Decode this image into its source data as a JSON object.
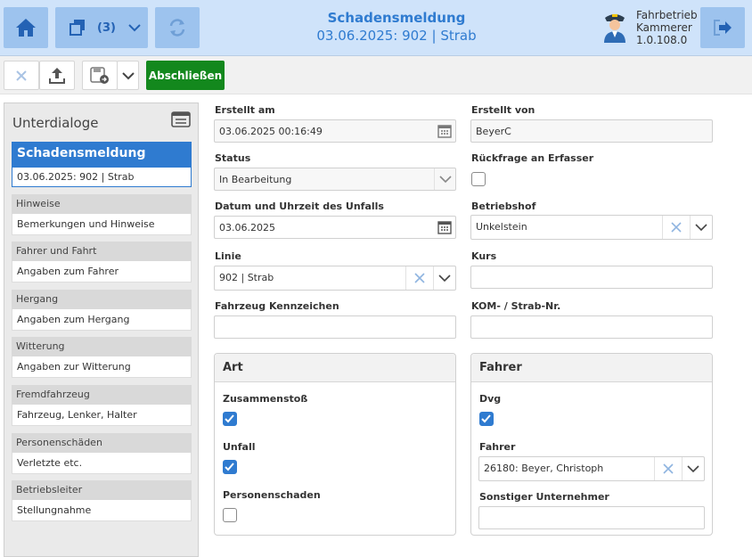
{
  "header": {
    "title": "Schadensmeldung",
    "subtitle": "03.06.2025: 902 | Strab",
    "windows_count": "(3)",
    "user_line1": "Fahrbetrieb",
    "user_line2": "Kammerer",
    "version": "1.0.108.0"
  },
  "toolbar": {
    "finish_label": "Abschließen"
  },
  "sidebar": {
    "title": "Unterdialoge",
    "active": {
      "title": "Schadensmeldung",
      "sub": "03.06.2025: 902 | Strab"
    },
    "items": [
      {
        "label": "Hinweise",
        "sub": "Bemerkungen und Hinweise"
      },
      {
        "label": "Fahrer und Fahrt",
        "sub": "Angaben zum Fahrer"
      },
      {
        "label": "Hergang",
        "sub": "Angaben zum Hergang"
      },
      {
        "label": "Witterung",
        "sub": "Angaben zur Witterung"
      },
      {
        "label": "Fremdfahrzeug",
        "sub": "Fahrzeug, Lenker, Halter"
      },
      {
        "label": "Personenschäden",
        "sub": "Verletzte etc."
      },
      {
        "label": "Betriebsleiter",
        "sub": "Stellungnahme"
      }
    ]
  },
  "form": {
    "erstellt_am": {
      "label": "Erstellt am",
      "value": "03.06.2025 00:16:49"
    },
    "erstellt_von": {
      "label": "Erstellt von",
      "value": "BeyerC"
    },
    "status": {
      "label": "Status",
      "value": "In Bearbeitung"
    },
    "rueckfrage": {
      "label": "Rückfrage an Erfasser",
      "checked": false
    },
    "datum": {
      "label": "Datum und Uhrzeit des Unfalls",
      "value": "03.06.2025"
    },
    "betriebshof": {
      "label": "Betriebshof",
      "value": "Unkelstein"
    },
    "linie": {
      "label": "Linie",
      "value": "902 | Strab"
    },
    "kurs": {
      "label": "Kurs",
      "value": ""
    },
    "kennzeichen": {
      "label": "Fahrzeug Kennzeichen",
      "value": ""
    },
    "kom": {
      "label": "KOM- / Strab-Nr.",
      "value": ""
    }
  },
  "art": {
    "title": "Art",
    "zusammenstoss": {
      "label": "Zusammenstoß",
      "checked": true
    },
    "unfall": {
      "label": "Unfall",
      "checked": true
    },
    "personenschaden": {
      "label": "Personenschaden",
      "checked": false
    }
  },
  "fahrer": {
    "title": "Fahrer",
    "dvg": {
      "label": "Dvg",
      "checked": true
    },
    "fahrer": {
      "label": "Fahrer",
      "value": "26180: Beyer, Christoph"
    },
    "sonstiger": {
      "label": "Sonstiger Unternehmer",
      "value": ""
    }
  },
  "colors": {
    "accent": "#2f7bd0",
    "finish": "#13881d",
    "header_bg": "#cfe3fa"
  }
}
